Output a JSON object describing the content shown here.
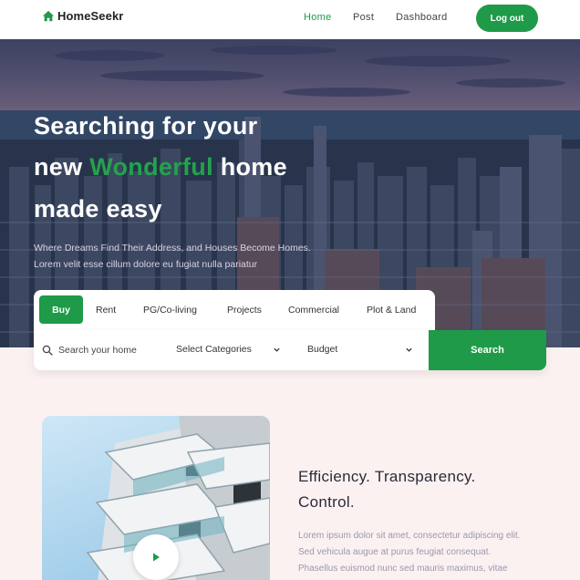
{
  "nav": {
    "brand": "HomeSeekr",
    "links": [
      {
        "label": "Home",
        "active": true
      },
      {
        "label": "Post",
        "active": false
      },
      {
        "label": "Dashboard",
        "active": false
      }
    ],
    "logout": "Log out"
  },
  "hero": {
    "line1": "Searching for your",
    "line2_pre": "new ",
    "line2_highlight": "Wonderful",
    "line2_post": " home",
    "line3": "made easy",
    "sub1": "Where Dreams Find Their Address, and Houses Become Homes.",
    "sub2": "Lorem velit esse cillum dolore eu fugiat nulla pariatur"
  },
  "search": {
    "tabs": [
      "Buy",
      "Rent",
      "PG/Co-living",
      "Projects",
      "Commercial",
      "Plot & Land"
    ],
    "input_placeholder": "Search your home",
    "category_label": "Select Categories",
    "budget_label": "Budget",
    "button": "Search"
  },
  "content": {
    "heading1": "Efficiency. Transparency.",
    "heading2": "Control.",
    "text": [
      "Lorem ipsum dolor sit amet, consectetur adipiscing elit.",
      "Sed vehicula augue at purus feugiat consequat.",
      "Phasellus euismod nunc sed mauris maximus, vitae"
    ]
  },
  "colors": {
    "accent": "#1e9a48",
    "page_bg": "#fbf1f1"
  },
  "icons": [
    "home-icon",
    "search-icon",
    "chevron-down-icon",
    "play-icon"
  ]
}
